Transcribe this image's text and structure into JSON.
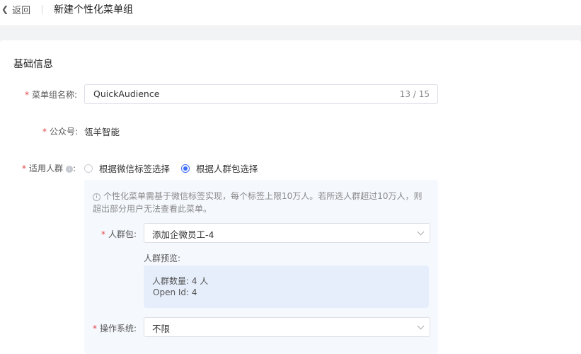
{
  "header": {
    "back_label": "返回",
    "title": "新建个性化菜单组"
  },
  "form": {
    "section_title": "基础信息",
    "menu_group_name": {
      "label": "菜单组名称:",
      "value": "QuickAudience",
      "counter": "13 / 15"
    },
    "official_account": {
      "label": "公众号:",
      "value": "瓴羊智能"
    },
    "audience": {
      "label": "适用人群",
      "label_suffix": ":",
      "options": [
        {
          "label": "根据微信标签选择",
          "checked": false
        },
        {
          "label": "根据人群包选择",
          "checked": true
        }
      ]
    },
    "hint": "个性化菜单需基于微信标签实现，每个标签上限10万人。若所选人群超过10万人，则超出部分用户无法查看此菜单。",
    "crowd_pack": {
      "label": "人群包:",
      "value": "添加企微员工-4"
    },
    "preview": {
      "label": "人群预览:",
      "count_line": "人群数量: 4 人",
      "openid_line": "Open Id: 4"
    },
    "os": {
      "label": "操作系统:",
      "value": "不限"
    }
  },
  "colors": {
    "accent": "#3b6cf5",
    "required": "#e5484d",
    "panel_bg": "#f5f8fd",
    "preview_bg": "#e6eefb"
  }
}
